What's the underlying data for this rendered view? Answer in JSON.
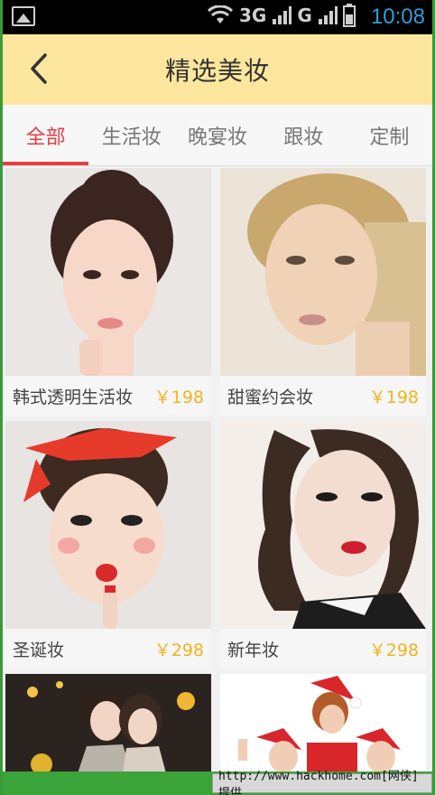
{
  "status_bar": {
    "network_1": "3G",
    "network_2": "G",
    "time": "10:08"
  },
  "header": {
    "title": "精选美妆"
  },
  "tabs": [
    {
      "label": "全部",
      "active": true
    },
    {
      "label": "生活妆",
      "active": false
    },
    {
      "label": "晚宴妆",
      "active": false
    },
    {
      "label": "跟妆",
      "active": false
    },
    {
      "label": "定制",
      "active": false
    }
  ],
  "cards": [
    {
      "name": "韩式透明生活妆",
      "price": "￥198"
    },
    {
      "name": "甜蜜约会妆",
      "price": "￥198"
    },
    {
      "name": "圣诞妆",
      "price": "￥298"
    },
    {
      "name": "新年妆",
      "price": "￥298"
    }
  ],
  "watermark": "http://www.hackhome.com[网侠]提供",
  "colors": {
    "header_bg": "#fde69d",
    "accent": "#e43d45",
    "price": "#f2b31e"
  }
}
